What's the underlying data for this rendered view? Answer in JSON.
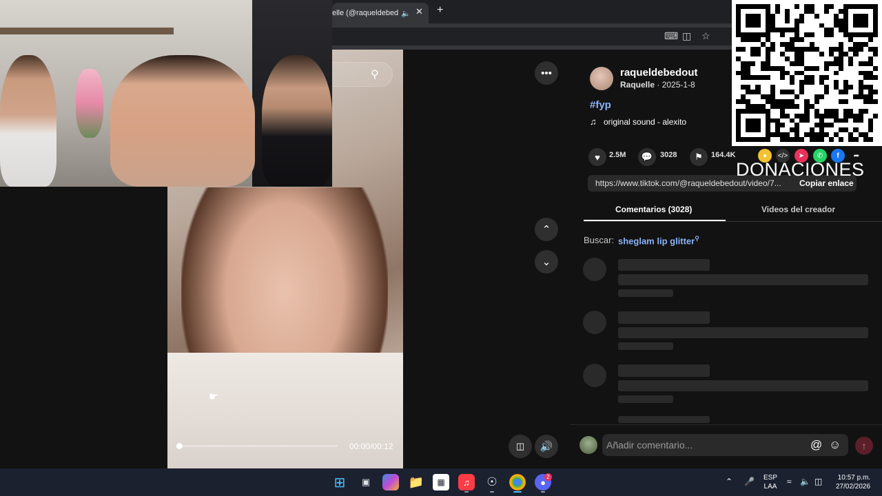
{
  "browser": {
    "tab_title": "elle (@raqueldebedout",
    "tab_audio_icon": "speaker-icon",
    "tab_close": "✕",
    "new_tab": "+"
  },
  "video": {
    "time": "00:00/00:12",
    "progress": 0.02
  },
  "author": {
    "username": "raqueldebedout",
    "display_name": "Raquelle",
    "date": "2025-1-8"
  },
  "post": {
    "hashtag": "#fyp",
    "sound": "original sound - alexito"
  },
  "stats": {
    "likes": "2.5M",
    "comments": "3028",
    "saves": "164.4K"
  },
  "overlay": {
    "donations_label": "DONACIONES"
  },
  "share": {
    "link": "https://www.tiktok.com/@raqueldebedout/video/7...",
    "copy_label": "Copiar enlace"
  },
  "tabs": {
    "comments": "Comentarios (3028)",
    "creator_videos": "Videos del creador"
  },
  "search": {
    "prefix": "Buscar:",
    "term": "sheglam lip glitter"
  },
  "comment_box": {
    "placeholder": "Añadir comentario..."
  },
  "taskbar": {
    "lang_line1": "ESP",
    "lang_line2": "LAA",
    "time": "10:57 p.m.",
    "date": "27/02/2026",
    "discord_badge": "2"
  },
  "colors": {
    "accent_link": "#8ab4f8",
    "panel_bg": "#121212",
    "taskbar_bg": "#1c2130"
  }
}
